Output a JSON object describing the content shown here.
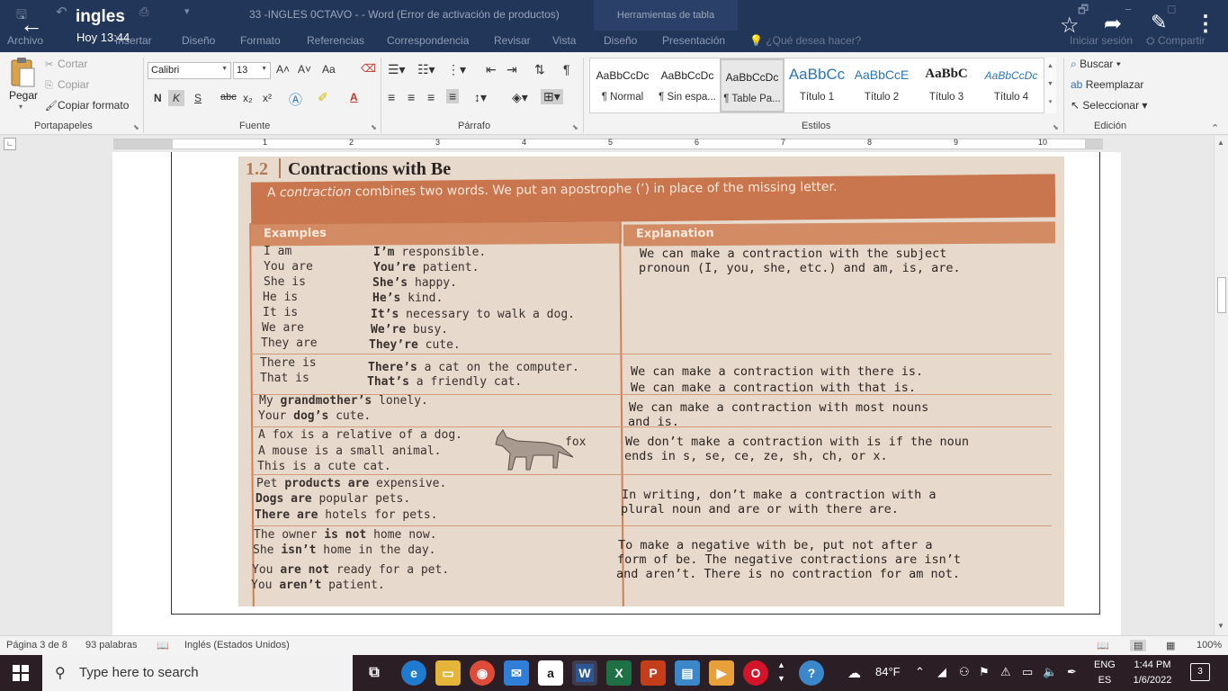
{
  "titlebar": {
    "doc_name": "ingles",
    "time": "Hoy 13:44",
    "window_title": "33 -INGLES 0CTAVO - - Word (Error de activación de productos)",
    "context_tools": "Herramientas de tabla",
    "tabs": [
      "Archivo",
      "Insertar",
      "Diseño",
      "Formato",
      "Referencias",
      "Correspondencia",
      "Revisar",
      "Vista",
      "Diseño",
      "Presentación"
    ],
    "tell_me": "¿Qué desea hacer?",
    "sign_in": "Iniciar sesión",
    "share": "Compartir"
  },
  "ribbon": {
    "clipboard": {
      "paste": "Pegar",
      "cut": "Cortar",
      "copy": "Copiar",
      "format_painter": "Copiar formato",
      "label": "Portapapeles"
    },
    "font": {
      "family": "Calibri",
      "size": "13",
      "label": "Fuente",
      "bold": "N",
      "italic": "K",
      "underline": "S",
      "strike": "abc",
      "sub": "x₂",
      "sup": "x²",
      "grow": "A˄",
      "shrink": "A˅",
      "case": "Aa",
      "color_letter": "A"
    },
    "paragraph": {
      "label": "Párrafo"
    },
    "styles": {
      "label": "Estilos",
      "items": [
        {
          "sample": "AaBbCcDc",
          "name": "¶ Normal"
        },
        {
          "sample": "AaBbCcDc",
          "name": "¶ Sin espa..."
        },
        {
          "sample": "AaBbCcDc",
          "name": "¶ Table Pa..."
        },
        {
          "sample": "AaBbCc",
          "name": "Título 1"
        },
        {
          "sample": "AaBbCcE",
          "name": "Título 2"
        },
        {
          "sample": "AaBbC",
          "name": "Título 3"
        },
        {
          "sample": "AaBbCcDc",
          "name": "Título 4"
        }
      ]
    },
    "editing": {
      "label": "Edición",
      "find": "Buscar",
      "replace": "Reemplazar",
      "select": "Seleccionar"
    }
  },
  "ruler": {
    "numbers": [
      "1",
      "2",
      "3",
      "4",
      "5",
      "6",
      "7",
      "8",
      "9",
      "10"
    ]
  },
  "scan": {
    "section_num": "1.2",
    "title": "Contractions with Be",
    "banner_pre": "A ",
    "banner_em": "contraction",
    "banner_post": " combines two words. We put an apostrophe (’) in place of the missing letter.",
    "head_examples": "Examples",
    "head_explanation": "Explanation",
    "fox_label": "fox",
    "rows": [
      {
        "l": "I am",
        "b": "I’m",
        "r": " responsible."
      },
      {
        "l": "You are",
        "b": "You’re",
        "r": " patient."
      },
      {
        "l": "She is",
        "b": "She’s",
        "r": " happy."
      },
      {
        "l": "He is",
        "b": "He’s",
        "r": " kind."
      },
      {
        "l": "It is",
        "b": "It’s",
        "r": " necessary to walk a dog."
      },
      {
        "l": "We are",
        "b": "We’re",
        "r": " busy."
      },
      {
        "l": "They are",
        "b": "They’re",
        "r": " cute."
      },
      {
        "l": "There is",
        "b": "There’s",
        "r": " a cat on the computer."
      },
      {
        "l": "That is",
        "b": "That’s",
        "r": " a friendly cat."
      }
    ],
    "nouns": [
      {
        "a": "My ",
        "b": "grandmother’s",
        "c": " lonely."
      },
      {
        "a": "Your ",
        "b": "dog’s",
        "c": " cute."
      }
    ],
    "fox_lines": [
      "A fox is a relative of a dog.",
      "A mouse is a small animal.",
      "This is a cute cat."
    ],
    "plural": [
      {
        "a": "Pet ",
        "b": "products are",
        "c": " expensive."
      },
      {
        "a": "",
        "b": "Dogs are",
        "c": " popular pets."
      },
      {
        "a": "",
        "b": "There are",
        "c": " hotels for pets."
      }
    ],
    "neg": [
      {
        "a": "The owner ",
        "b": "is not",
        "c": " home now."
      },
      {
        "a": "She ",
        "b": "isn’t",
        "c": " home in the day."
      },
      {
        "a": "You ",
        "b": "are not",
        "c": " ready for a pet."
      },
      {
        "a": "You ",
        "b": "aren’t",
        "c": " patient."
      }
    ],
    "exp1": [
      "We can make a contraction with the subject",
      "pronoun (I, you, she, etc.) and am, is, are."
    ],
    "exp2": [
      "We can make a contraction with there is.",
      "We can make a contraction with that is."
    ],
    "exp3": [
      "We can make a contraction with most nouns",
      "and is."
    ],
    "exp4": [
      "We don’t make a contraction with is if the noun",
      "ends in s, se, ce, ze, sh, ch, or x."
    ],
    "exp5": [
      "In writing, don’t make a contraction with a",
      "plural noun and are or with there are."
    ],
    "exp6": [
      "To make a negative with be, put not after a",
      "form of be. The negative contractions are isn’t",
      "and aren’t. There is no contraction for am not."
    ]
  },
  "statusbar": {
    "page": "Página 3 de 8",
    "words": "93 palabras",
    "language": "Inglés (Estados Unidos)",
    "zoom": "100%"
  },
  "taskbar": {
    "search_placeholder": "Type here to search",
    "weather": "84°F",
    "lang1": "ENG",
    "lang2": "ES",
    "time": "1:44 PM",
    "date": "1/6/2022",
    "notif_count": "3"
  }
}
